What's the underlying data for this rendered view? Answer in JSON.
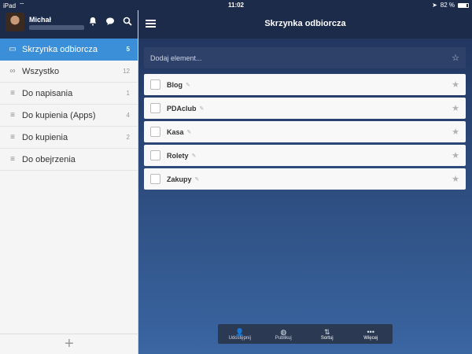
{
  "status": {
    "device": "iPad",
    "time": "11:02",
    "battery": "82 %"
  },
  "sidebar": {
    "user": {
      "name": "Michał"
    },
    "items": [
      {
        "label": "Skrzynka odbiorcza",
        "count": "5",
        "icon": "inbox-icon",
        "active": true
      },
      {
        "label": "Wszystko",
        "count": "12",
        "icon": "infinity-icon"
      },
      {
        "label": "Do napisania",
        "count": "1",
        "icon": "list-icon"
      },
      {
        "label": "Do kupienia (Apps)",
        "count": "4",
        "icon": "list-icon"
      },
      {
        "label": "Do kupienia",
        "count": "2",
        "icon": "list-icon"
      },
      {
        "label": "Do obejrzenia",
        "count": "",
        "icon": "list-icon"
      }
    ],
    "footer_add": "+"
  },
  "main": {
    "title": "Skrzynka odbiorcza",
    "add_placeholder": "Dodaj element...",
    "tasks": [
      {
        "name": "Blog"
      },
      {
        "name": "PDAclub"
      },
      {
        "name": "Kasa"
      },
      {
        "name": "Rolety"
      },
      {
        "name": "Zakupy"
      }
    ]
  },
  "toolbar": {
    "share": "Udostępnij",
    "publish": "Publikuj",
    "sort": "Sortuj",
    "more": "Więcej"
  },
  "colors": {
    "accent": "#3b8fd8",
    "header": "#1d2b4b"
  }
}
